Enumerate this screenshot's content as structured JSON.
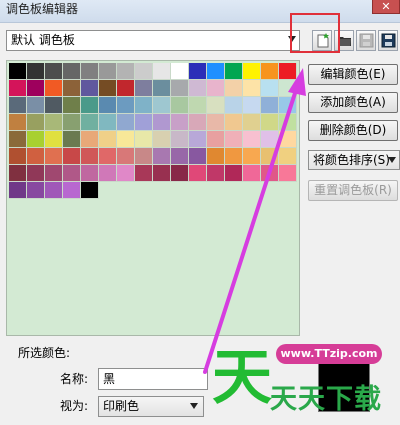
{
  "window": {
    "title": "调色板编辑器",
    "close_glyph": "✕"
  },
  "palette_select": {
    "value": "默认 调色板"
  },
  "toolbar": {
    "tools": [
      {
        "name": "new-palette",
        "icon": "new-document-icon",
        "highlighted": true
      },
      {
        "name": "open-palette",
        "icon": "folder-icon"
      },
      {
        "name": "save-palette",
        "icon": "save-icon",
        "disabled": true
      },
      {
        "name": "save-as-palette",
        "icon": "save-as-icon"
      }
    ]
  },
  "buttons": {
    "edit_color": "编辑颜色(E)",
    "add_color": "添加颜色(A)",
    "delete_color": "删除颜色(D)",
    "sort_colors": "将颜色排序(S)",
    "reset_palette": "重置调色板(R)"
  },
  "swatch_area_color": "#d3ead3",
  "colors": [
    "#000000",
    "#333333",
    "#4d4d4d",
    "#666666",
    "#808080",
    "#999999",
    "#b3b3b3",
    "#cccccc",
    "#e6e6e6",
    "#ffffff",
    "#2b2eb8",
    "#1e90ff",
    "#00a651",
    "#fff200",
    "#f7941d",
    "#ed1c24",
    "#d4145a",
    "#9e005d",
    "#f15a24",
    "#8c6239",
    "#60589e",
    "#754c24",
    "#c1272d",
    "#7e7e9e",
    "#6b8e9e",
    "#a7a9ac",
    "#cfb9d3",
    "#e8b4cc",
    "#f3d1a8",
    "#fde3a7",
    "#b8e0f0",
    "#cde6d0",
    "#5a6a7a",
    "#7a8fa6",
    "#505a62",
    "#6f7f4a",
    "#4a9a8a",
    "#5a8ab0",
    "#6c9bc0",
    "#7fb2c8",
    "#9ec7d0",
    "#a8c8a0",
    "#bfd8b0",
    "#d8e0c0",
    "#b9d3e8",
    "#c6d9f0",
    "#8fb0d8",
    "#98c8e8",
    "#c08040",
    "#98a060",
    "#a8b878",
    "#88a070",
    "#70b0a0",
    "#80b8c0",
    "#90a8d0",
    "#a0a0d8",
    "#b098d0",
    "#c8a0c8",
    "#d8a8b8",
    "#e8b8a8",
    "#f0c890",
    "#e0d090",
    "#d0d888",
    "#c0e0a0",
    "#8a6a3a",
    "#a8d030",
    "#e0e040",
    "#6a7a50",
    "#e8a878",
    "#f0d088",
    "#f8e898",
    "#e8e8a8",
    "#d8d0b0",
    "#c8b8c8",
    "#b8a8d8",
    "#e8a0a0",
    "#f0b0b8",
    "#f8c0d0",
    "#e0c0e8",
    "#ffd8a0",
    "#b05030",
    "#d06040",
    "#e07050",
    "#c84848",
    "#d05858",
    "#e06868",
    "#d87878",
    "#c88888",
    "#a878b0",
    "#9868a8",
    "#8858a0",
    "#e08830",
    "#f09840",
    "#f8a850",
    "#e8c070",
    "#f0d080",
    "#803040",
    "#903858",
    "#a04870",
    "#b05888",
    "#c068a0",
    "#d078b8",
    "#e088c8",
    "#a83858",
    "#983050",
    "#882848",
    "#e04878",
    "#c03868",
    "#b02858",
    "#f06898",
    "#e05888",
    "#f87898",
    "#703888",
    "#8848a0",
    "#a058b8",
    "#b868d0",
    "#000000"
  ],
  "selected": {
    "section_label": "所选颜色:",
    "name_label": "名称:",
    "name_value": "黑",
    "view_label": "视为:",
    "view_value": "印刷色",
    "preview_color": "#000000"
  },
  "watermark": {
    "url": "www.TTzip.com",
    "brand": "天天下载",
    "sky_glyph": "天"
  }
}
